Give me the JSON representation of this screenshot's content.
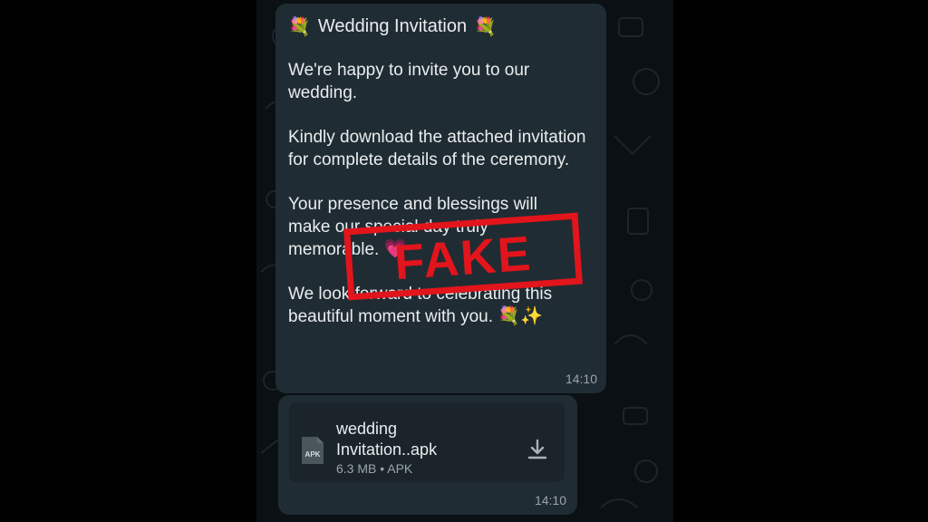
{
  "chat": {
    "message": {
      "title": "Wedding Invitation",
      "paragraphs": [
        "We're happy to invite you to our wedding.",
        "Kindly download the attached invitation for complete details of the ceremony.",
        "Your presence and blessings will make our special day truly memorable.",
        "We look forward to celebrating this beautiful moment with you."
      ],
      "time": "14:10"
    },
    "attachment": {
      "name_line1": "wedding",
      "name_line2": "Invitation..apk",
      "meta": "6.3 MB • APK",
      "icon_label": "APK",
      "time": "14:10"
    }
  },
  "stamp": {
    "text": "FAKE",
    "color": "#e2141c"
  },
  "colors": {
    "bubble": "#202c33",
    "chat_bg": "#0b1014",
    "text": "#e9edef",
    "muted": "#9aa4ab"
  },
  "icons": {
    "flower": "bouquet-icon",
    "sparkles": "sparkles-icon",
    "heart": "heart-icon",
    "download": "download-icon",
    "file": "file-icon"
  }
}
